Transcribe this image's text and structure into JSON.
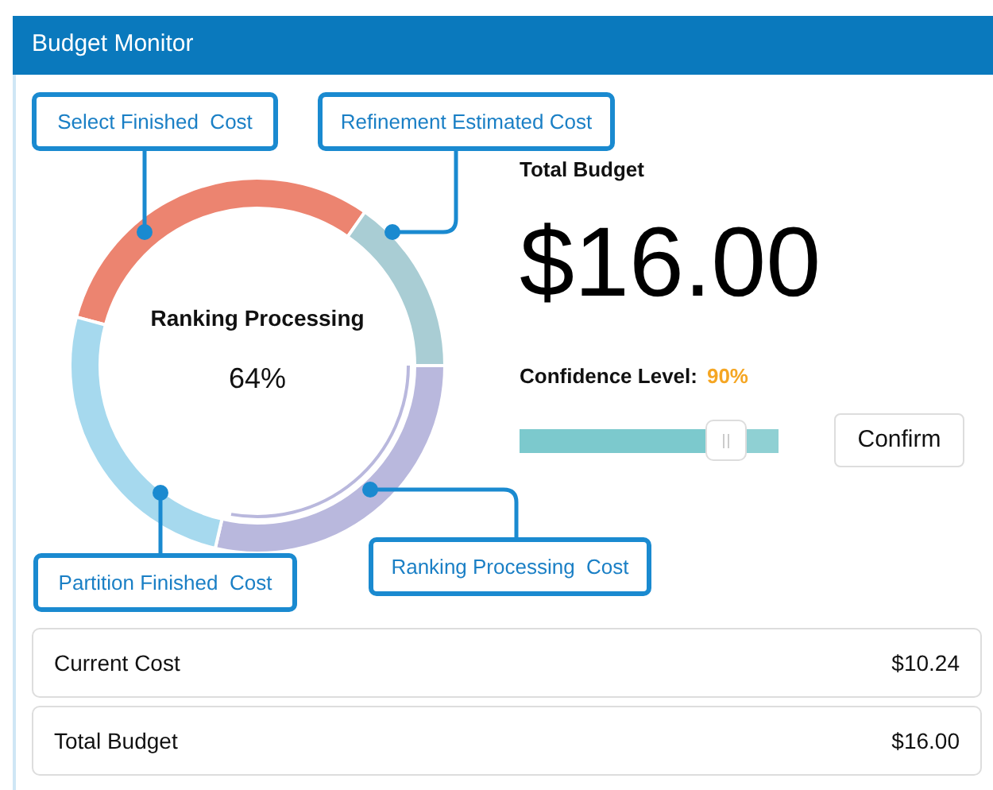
{
  "window": {
    "title": "Budget Monitor"
  },
  "donut": {
    "center_label": "Ranking Processing",
    "center_value": "64%",
    "segments": [
      {
        "label": "Select Finished  Cost",
        "color": "#ec8470"
      },
      {
        "label": "Refinement Estimated Cost",
        "color": "#a9cdd4"
      },
      {
        "label": "Ranking Processing  Cost",
        "color": "#b9b8dd"
      },
      {
        "label": "Partition Finished  Cost",
        "color": "#a6d9ee"
      }
    ]
  },
  "budget": {
    "label": "Total Budget",
    "amount": "$16.00"
  },
  "confidence": {
    "label": "Confidence Level:",
    "value": "90%",
    "level": 0.8
  },
  "confirm_button": "Confirm",
  "summary": [
    {
      "label": "Current Cost",
      "value": "$10.24"
    },
    {
      "label": "Total Budget",
      "value": "$16.00"
    }
  ]
}
